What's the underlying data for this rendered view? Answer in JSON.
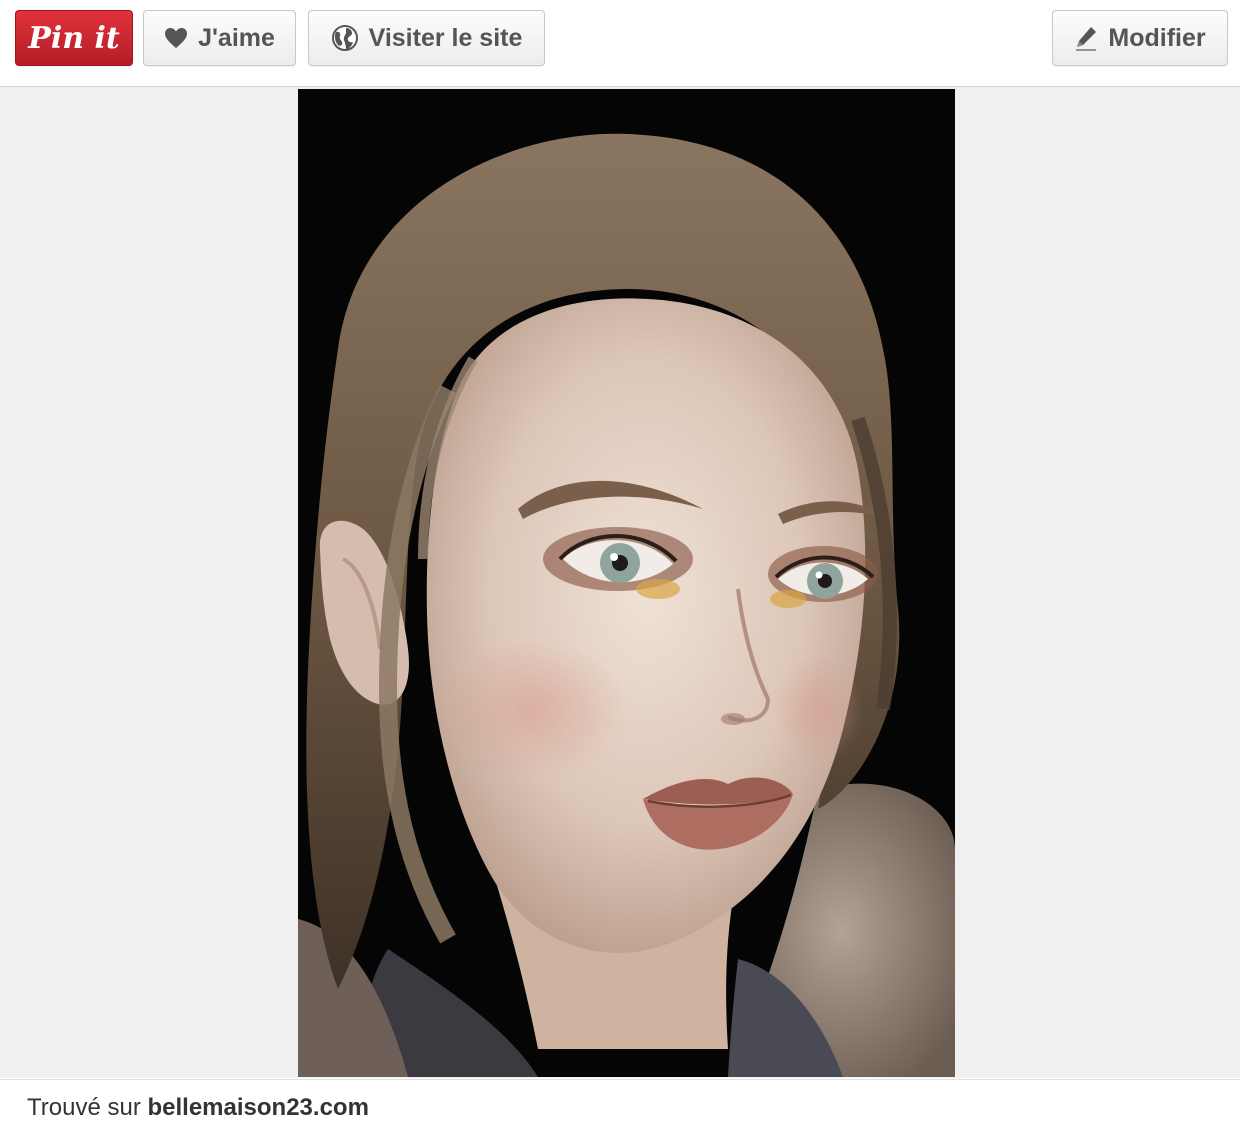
{
  "toolbar": {
    "pin_label": "Pin it",
    "like_label": "J'aime",
    "visit_label": "Visiter le site",
    "edit_label": "Modifier"
  },
  "icons": {
    "like": "heart-icon",
    "visit": "globe-icon",
    "edit": "pencil-icon"
  },
  "footer": {
    "source_prefix": "Trouvé sur",
    "source_domain": "bellemaison23.com"
  },
  "colors": {
    "pin_red": "#cb2027",
    "page_background": "#f0f0f0",
    "text": "#333333"
  }
}
